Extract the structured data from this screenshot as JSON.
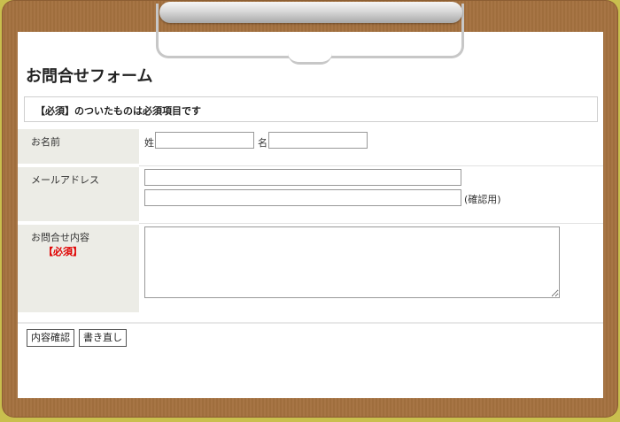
{
  "form": {
    "title": "お問合せフォーム",
    "notice": "【必須】のついたものは必須項目です"
  },
  "fields": {
    "name": {
      "label": "お名前",
      "last_label": "姓:",
      "last_value": "",
      "first_label": "名:",
      "first_value": ""
    },
    "email": {
      "label": "メールアドレス",
      "value": "",
      "confirm_value": "",
      "confirm_note": "(確認用)"
    },
    "message": {
      "label": "お問合せ内容",
      "required": "【必須】",
      "value": ""
    }
  },
  "buttons": {
    "confirm": "内容確認",
    "reset": "書き直し"
  },
  "colors": {
    "board": "#a4713f",
    "background": "#c9bf4e",
    "label_bg": "#ecece6",
    "required": "#e00000"
  }
}
